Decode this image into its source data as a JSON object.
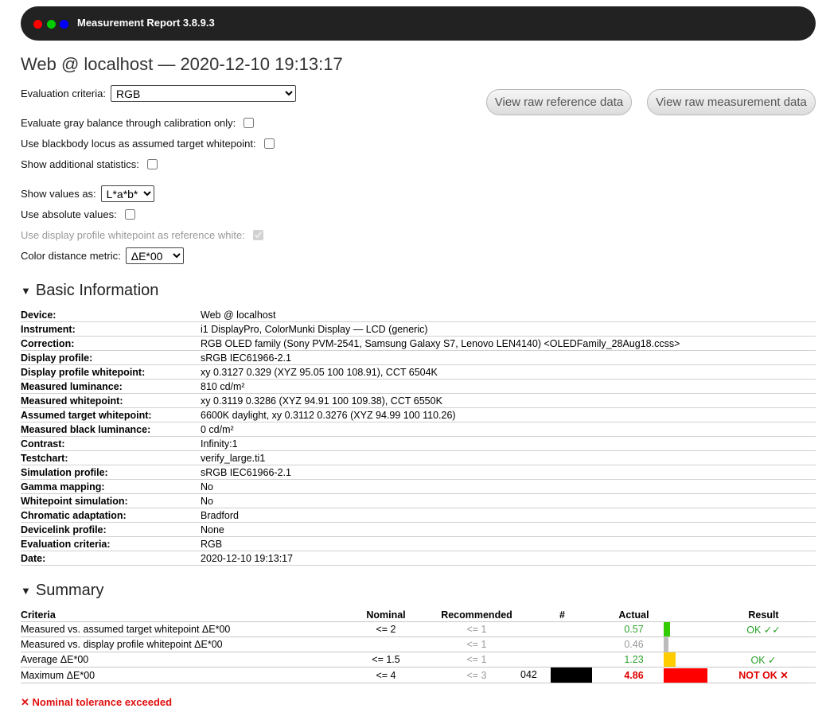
{
  "window": {
    "title": "Measurement Report 3.8.9.3"
  },
  "heading": "Web @ localhost — 2020-12-10 19:13:17",
  "controls": {
    "evaluation_criteria_label": "Evaluation criteria:",
    "evaluation_criteria_value": "RGB",
    "gray_balance_label": "Evaluate gray balance through calibration only:",
    "blackbody_label": "Use blackbody locus as assumed target whitepoint:",
    "additional_stats_label": "Show additional statistics:",
    "show_values_label": "Show values as:",
    "show_values_value": "L*a*b*",
    "absolute_values_label": "Use absolute values:",
    "display_profile_wp_label": "Use display profile whitepoint as reference white:",
    "color_metric_label": "Color distance metric:",
    "color_metric_value": "ΔE*00"
  },
  "buttons": {
    "raw_reference": "View raw reference data",
    "raw_measurement": "View raw measurement data"
  },
  "basic_info": {
    "title": "Basic Information",
    "rows": [
      {
        "key": "Device:",
        "value": "Web @ localhost"
      },
      {
        "key": "Instrument:",
        "value": "i1 DisplayPro, ColorMunki Display — LCD (generic)"
      },
      {
        "key": "Correction:",
        "value": "RGB OLED family (Sony PVM-2541, Samsung Galaxy S7, Lenovo LEN4140) <OLEDFamily_28Aug18.ccss>"
      },
      {
        "key": "Display profile:",
        "value": "sRGB IEC61966-2.1"
      },
      {
        "key": "Display profile whitepoint:",
        "value": "xy 0.3127 0.329 (XYZ 95.05 100 108.91), CCT 6504K"
      },
      {
        "key": "Measured luminance:",
        "value": "810 cd/m²"
      },
      {
        "key": "Measured whitepoint:",
        "value": "xy 0.3119 0.3286 (XYZ 94.91 100 109.38), CCT 6550K"
      },
      {
        "key": "Assumed target whitepoint:",
        "value": "6600K daylight, xy 0.3112 0.3276 (XYZ 94.99 100 110.26)"
      },
      {
        "key": "Measured black luminance:",
        "value": "0 cd/m²"
      },
      {
        "key": "Contrast:",
        "value": "Infinity:1"
      },
      {
        "key": "Testchart:",
        "value": "verify_large.ti1"
      },
      {
        "key": "Simulation profile:",
        "value": "sRGB IEC61966-2.1"
      },
      {
        "key": "Gamma mapping:",
        "value": "No"
      },
      {
        "key": "Whitepoint simulation:",
        "value": "No"
      },
      {
        "key": "Chromatic adaptation:",
        "value": "Bradford"
      },
      {
        "key": "Devicelink profile:",
        "value": "None"
      },
      {
        "key": "Evaluation criteria:",
        "value": "RGB"
      },
      {
        "key": "Date:",
        "value": "2020-12-10 19:13:17"
      }
    ]
  },
  "summary": {
    "title": "Summary",
    "headers": {
      "criteria": "Criteria",
      "nominal": "Nominal",
      "recommended": "Recommended",
      "num": "#",
      "actual": "Actual",
      "result": "Result"
    },
    "rows": [
      {
        "criteria": "Measured vs. assumed target whitepoint ΔE*00",
        "nominal": "<= 2",
        "recommended": "<= 1",
        "num": "",
        "actual": "0.57",
        "result": "OK ✓✓",
        "bar_fraction": 0.14,
        "bar_color": "#33cc00"
      },
      {
        "criteria": "Measured vs. display profile whitepoint ΔE*00",
        "nominal": "",
        "recommended": "<= 1",
        "num": "",
        "actual": "0.46",
        "result": "",
        "bar_fraction": 0.11,
        "bar_color": "#bbbbbb"
      },
      {
        "criteria": "Average ΔE*00",
        "nominal": "<= 1.5",
        "recommended": "<= 1",
        "num": "",
        "actual": "1.23",
        "result": "OK ✓",
        "bar_fraction": 0.27,
        "bar_color": "#ffcc00"
      },
      {
        "criteria": "Maximum ΔE*00",
        "nominal": "<= 4",
        "recommended": "<= 3",
        "num": "042",
        "actual": "4.86",
        "result": "NOT OK ✕",
        "bar_fraction": 1.0,
        "bar_color": "#ff0000"
      }
    ]
  },
  "footer_note": "✕ Nominal tolerance exceeded"
}
